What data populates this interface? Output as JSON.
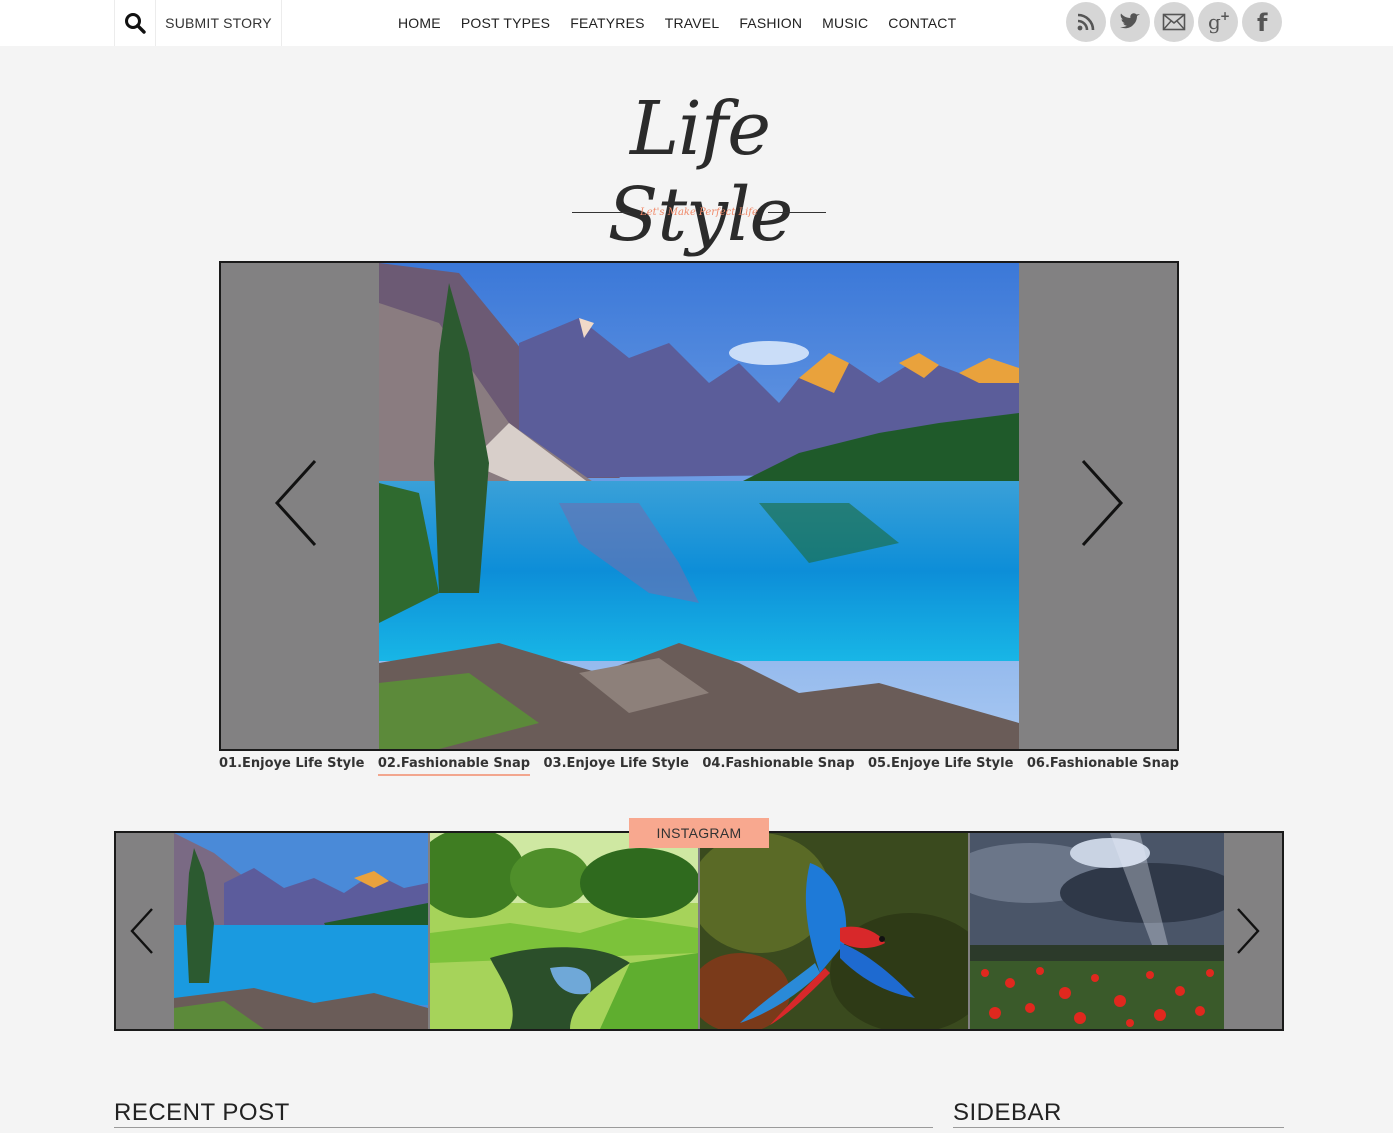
{
  "topbar": {
    "submit_label": "SUBMIT STORY",
    "nav": [
      {
        "label": "HOME"
      },
      {
        "label": "POST TYPES"
      },
      {
        "label": "FEATYRES"
      },
      {
        "label": "TRAVEL"
      },
      {
        "label": "FASHION"
      },
      {
        "label": "MUSIC"
      },
      {
        "label": "CONTACT"
      }
    ],
    "social": [
      "rss-icon",
      "twitter-icon",
      "email-icon",
      "google-plus-icon",
      "facebook-icon"
    ]
  },
  "logo": {
    "title": "Life Style",
    "tagline": "Let's Make Perfect Life"
  },
  "slider": {
    "tabs": [
      {
        "label": "01.Enjoye Life Style",
        "active": false
      },
      {
        "label": "02.Fashionable Snap",
        "active": true
      },
      {
        "label": "03.Enjoye Life Style",
        "active": false
      },
      {
        "label": "04.Fashionable Snap",
        "active": false
      },
      {
        "label": "05.Enjoye Life Style",
        "active": false
      },
      {
        "label": "06.Fashionable Snap",
        "active": false
      }
    ]
  },
  "instagram": {
    "label": "INSTAGRAM"
  },
  "sections": {
    "recent_post": "RECENT POST",
    "sidebar": "SIDEBAR"
  },
  "colors": {
    "accent": "#f8a88f",
    "frame": "#828182",
    "background": "#f4f4f4"
  }
}
